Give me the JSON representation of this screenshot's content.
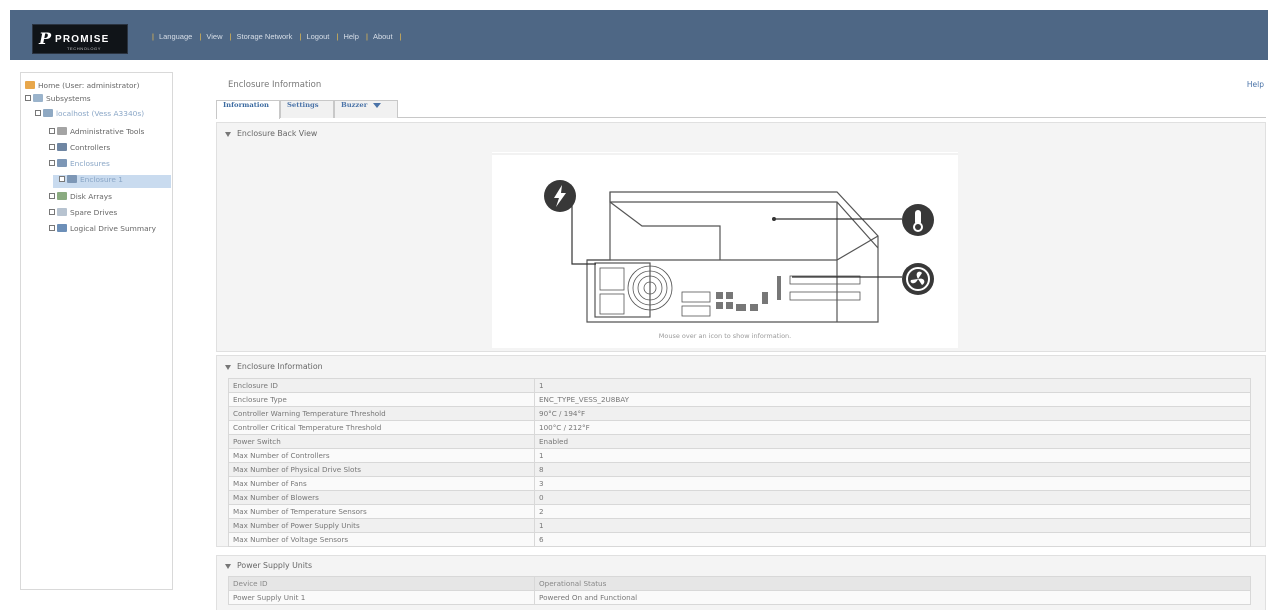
{
  "header": {
    "logo_text": "PROMISE",
    "logo_sub": "TECHNOLOGY",
    "nav": [
      "Language",
      "View",
      "Storage Network",
      "Logout",
      "Help",
      "About"
    ]
  },
  "tree": {
    "items": [
      {
        "label": "Home (User: administrator)",
        "icon": "home-icon"
      },
      {
        "label": "Subsystems",
        "icon": "subsystems-icon"
      },
      {
        "label": "localhost (Vess A3340s)",
        "icon": "server-icon"
      },
      {
        "label": "Administrative Tools",
        "icon": "tools-icon"
      },
      {
        "label": "Controllers",
        "icon": "controller-icon"
      },
      {
        "label": "Enclosures",
        "icon": "enclosure-icon"
      },
      {
        "label": "Enclosure 1",
        "icon": "enclosure-icon"
      },
      {
        "label": "Disk Arrays",
        "icon": "disk-array-icon"
      },
      {
        "label": "Spare Drives",
        "icon": "spare-drive-icon"
      },
      {
        "label": "Logical Drive Summary",
        "icon": "logical-drive-icon"
      }
    ]
  },
  "page": {
    "title": "Enclosure Information",
    "help": "Help",
    "tabs": [
      "Information",
      "Settings",
      "Buzzer"
    ]
  },
  "back_view": {
    "heading": "Enclosure Back View",
    "hint": "Mouse over an icon to show information.",
    "icons": [
      "power-icon",
      "thermometer-icon",
      "fan-icon"
    ]
  },
  "enclosure_info": {
    "heading": "Enclosure Information",
    "rows": [
      [
        "Enclosure ID",
        "1"
      ],
      [
        "Enclosure Type",
        "ENC_TYPE_VESS_2U8BAY"
      ],
      [
        "Controller Warning Temperature Threshold",
        "90°C / 194°F"
      ],
      [
        "Controller Critical Temperature Threshold",
        "100°C / 212°F"
      ],
      [
        "Power Switch",
        "Enabled"
      ],
      [
        "Max Number of Controllers",
        "1"
      ],
      [
        "Max Number of Physical Drive Slots",
        "8"
      ],
      [
        "Max Number of Fans",
        "3"
      ],
      [
        "Max Number of Blowers",
        "0"
      ],
      [
        "Max Number of Temperature Sensors",
        "2"
      ],
      [
        "Max Number of Power Supply Units",
        "1"
      ],
      [
        "Max Number of Voltage Sensors",
        "6"
      ]
    ]
  },
  "power_supply": {
    "heading": "Power Supply Units",
    "columns": [
      "Device ID",
      "Operational Status"
    ],
    "rows": [
      [
        "Power Supply Unit 1",
        "Powered On and Functional"
      ]
    ]
  }
}
